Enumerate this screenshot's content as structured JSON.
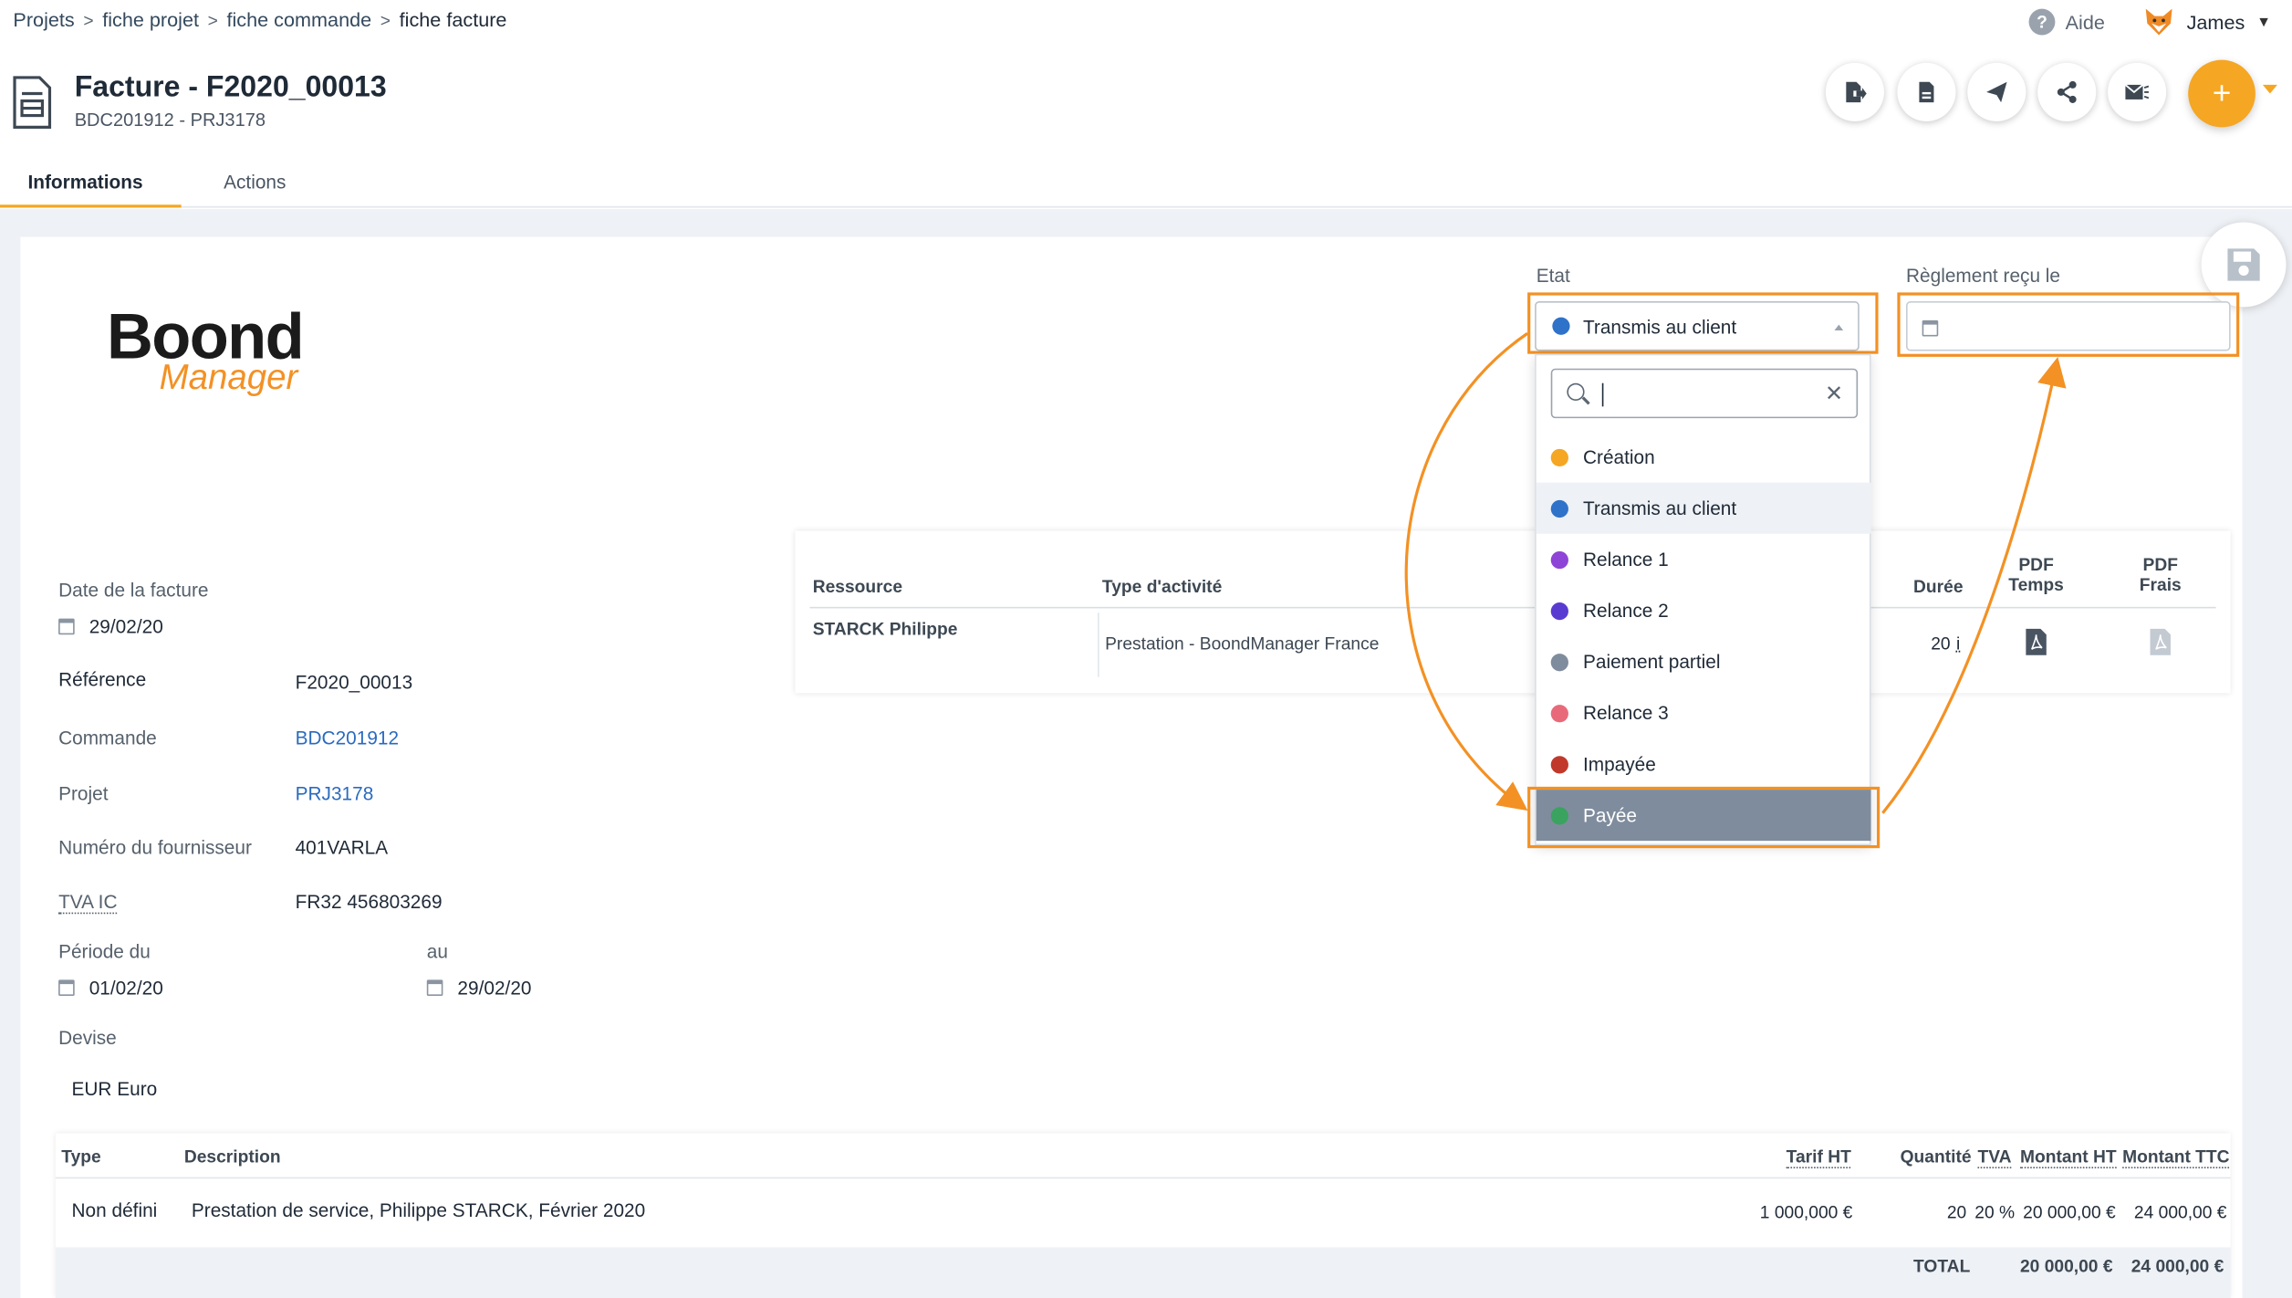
{
  "breadcrumb": [
    "Projets",
    "fiche projet",
    "fiche commande",
    "fiche facture"
  ],
  "help_label": "Aide",
  "user_name": "James",
  "header": {
    "title": "Facture - F2020_00013",
    "subtitle": "BDC201912 - PRJ3178"
  },
  "action_icons": [
    "export-icon",
    "pdf-icon",
    "send-icon",
    "share-icon",
    "mail-icon"
  ],
  "plus_label": "+",
  "tabs": [
    {
      "label": "Informations",
      "active": true
    },
    {
      "label": "Actions",
      "active": false
    }
  ],
  "logo": {
    "line1": "Boond",
    "line2": "Manager"
  },
  "etat": {
    "label": "Etat",
    "selected": "Transmis au client",
    "selected_color": "#2f72c9",
    "search_placeholder": "",
    "options": [
      {
        "label": "Création",
        "color": "#f5a623"
      },
      {
        "label": "Transmis au client",
        "color": "#2f72c9"
      },
      {
        "label": "Relance 1",
        "color": "#8e44d6"
      },
      {
        "label": "Relance 2",
        "color": "#5a3bd1"
      },
      {
        "label": "Paiement partiel",
        "color": "#7f8c9d"
      },
      {
        "label": "Relance 3",
        "color": "#e86a7a"
      },
      {
        "label": "Impayée",
        "color": "#c0392b"
      },
      {
        "label": "Payée",
        "color": "#3aa35f"
      }
    ],
    "hover_option": "Transmis au client",
    "highlighted_option": "Payée"
  },
  "reglement": {
    "label": "Règlement reçu le",
    "value": ""
  },
  "info": {
    "date_label": "Date de la facture",
    "date_value": "29/02/20",
    "ref_label": "Référence",
    "ref_value": "F2020_00013",
    "commande_label": "Commande",
    "commande_value": "BDC201912",
    "projet_label": "Projet",
    "projet_value": "PRJ3178",
    "fournisseur_label": "Numéro du fournisseur",
    "fournisseur_value": "401VARLA",
    "tva_label": "TVA IC",
    "tva_value": "FR32 456803269",
    "periode_label": "Période du",
    "periode_from": "01/02/20",
    "au_label": "au",
    "periode_to": "29/02/20",
    "devise_label": "Devise",
    "devise_value": "EUR Euro"
  },
  "resources": {
    "headers": {
      "ressource": "Ressource",
      "type": "Type d'activité",
      "duree": "Durée",
      "pdf_temps": "PDF Temps",
      "pdf_frais": "PDF Frais"
    },
    "rows": [
      {
        "ressource": "STARCK Philippe",
        "type": "Prestation - BoondManager France",
        "duree": "20",
        "info": "i"
      }
    ]
  },
  "lines": {
    "headers": {
      "type": "Type",
      "description": "Description",
      "tarif": "Tarif HT",
      "quantite": "Quantité",
      "tva": "TVA",
      "montant_ht": "Montant HT",
      "montant_ttc": "Montant TTC"
    },
    "rows": [
      {
        "type": "Non défini",
        "description": "Prestation de service, Philippe STARCK, Février 2020",
        "tarif": "1 000,000 €",
        "quantite": "20",
        "tva": "20 %",
        "montant_ht": "20 000,00 €",
        "montant_ttc": "24 000,00 €"
      }
    ],
    "total": {
      "label": "TOTAL",
      "ht": "20 000,00 €",
      "ttc": "24 000,00 €"
    }
  },
  "colors": {
    "accent": "#f5a623",
    "highlight": "#f39124",
    "link": "#2a6bbf"
  }
}
